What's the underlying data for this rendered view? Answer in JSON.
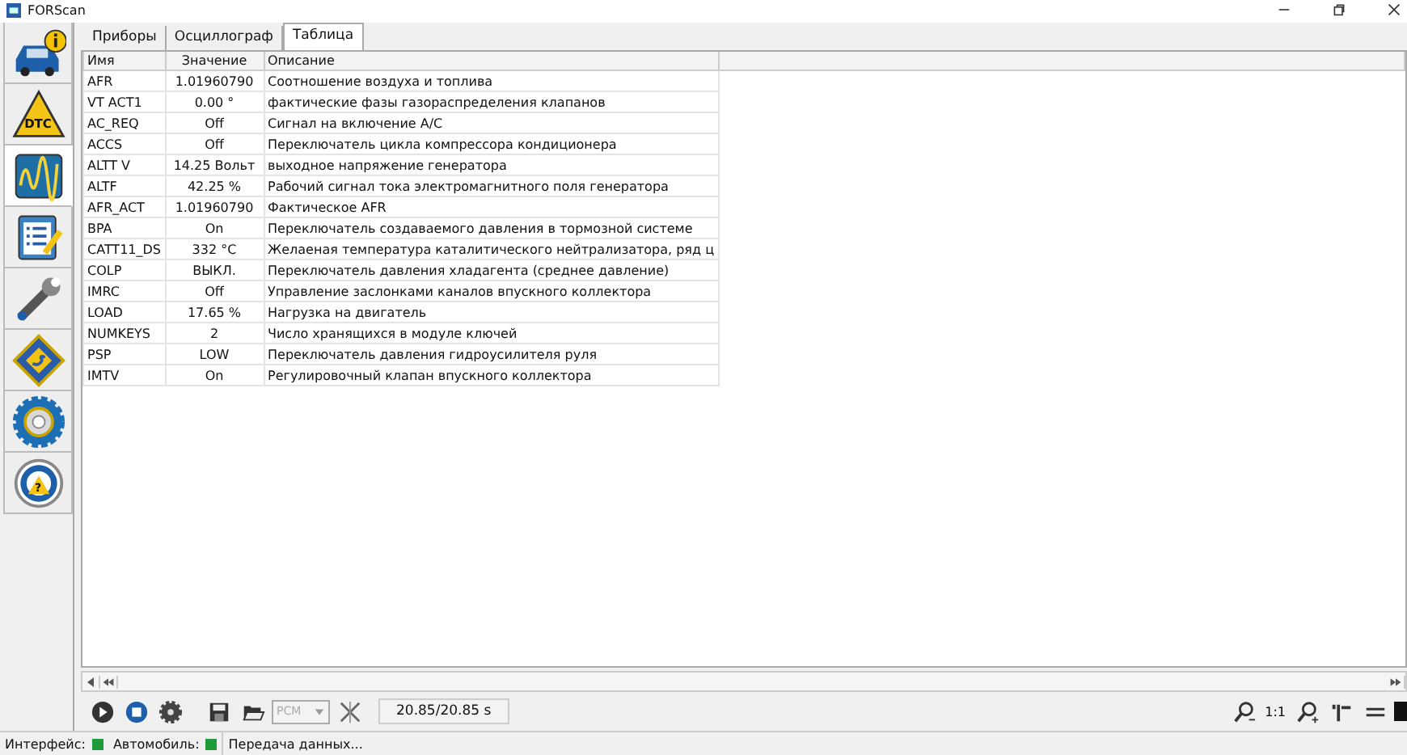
{
  "window": {
    "title": "FORScan"
  },
  "sidebar": {
    "items": [
      {
        "kind": "car-info",
        "selected": false
      },
      {
        "kind": "dtc",
        "text": "DTC",
        "selected": false
      },
      {
        "kind": "wave",
        "selected": true
      },
      {
        "kind": "checklist",
        "selected": false
      },
      {
        "kind": "wrench",
        "selected": false
      },
      {
        "kind": "chip",
        "selected": false
      },
      {
        "kind": "gear",
        "selected": false
      },
      {
        "kind": "wheel",
        "text": "?",
        "selected": false
      }
    ]
  },
  "tabs": [
    {
      "label": "Приборы",
      "selected": false
    },
    {
      "label": "Осциллограф",
      "selected": false
    },
    {
      "label": "Таблица",
      "selected": true
    }
  ],
  "table": {
    "columns": [
      "Имя",
      "Значение",
      "Описание"
    ],
    "rows": [
      [
        "AFR",
        "1.01960790",
        "Соотношение воздуха и топлива"
      ],
      [
        "VT ACT1",
        "0.00 °",
        "фактические фазы газораспределения клапанов"
      ],
      [
        "AC_REQ",
        "Off",
        "Сигнал на включение A/C"
      ],
      [
        "ACCS",
        "Off",
        "Переключатель цикла компрессора кондиционера"
      ],
      [
        "ALTT V",
        "14.25 Вольт",
        "выходное напряжение генератора"
      ],
      [
        "ALTF",
        "42.25 %",
        "Рабочий сигнал тока электромагнитного поля генератора"
      ],
      [
        "AFR_ACT",
        "1.01960790",
        "Фактическое AFR"
      ],
      [
        "BPA",
        "On",
        "Переключатель создаваемого давления в тормозной системе"
      ],
      [
        "CATT11_DS",
        "332 °C",
        "Желаеная температура каталитического нейтрализатора, ряд ц"
      ],
      [
        "COLP",
        "ВЫКЛ.",
        "Переключатель давления хладагента (среднее давление)"
      ],
      [
        "IMRC",
        "Off",
        "Управление заслонками каналов впускного коллектора"
      ],
      [
        "LOAD",
        "17.65 %",
        "Нагрузка на двигатель"
      ],
      [
        "NUMKEYS",
        "2",
        "Число хранящихся в модуле ключей"
      ],
      [
        "PSP",
        "LOW",
        "Переключатель давления гидроусилителя руля"
      ],
      [
        "IMTV",
        "On",
        "Регулировочный клапан впускного коллектора"
      ]
    ]
  },
  "toolbar": {
    "module": {
      "value": "PCM",
      "disabled": true
    },
    "time": "20.85/20.85 s",
    "zoom_reset": "1:1"
  },
  "status_bar": [
    {
      "label": "Интерфейс:",
      "color": "#1f9a3a"
    },
    {
      "label": "Автомобиль:",
      "color": "#1f9a3a"
    },
    {
      "label": "Передача данных..."
    }
  ]
}
